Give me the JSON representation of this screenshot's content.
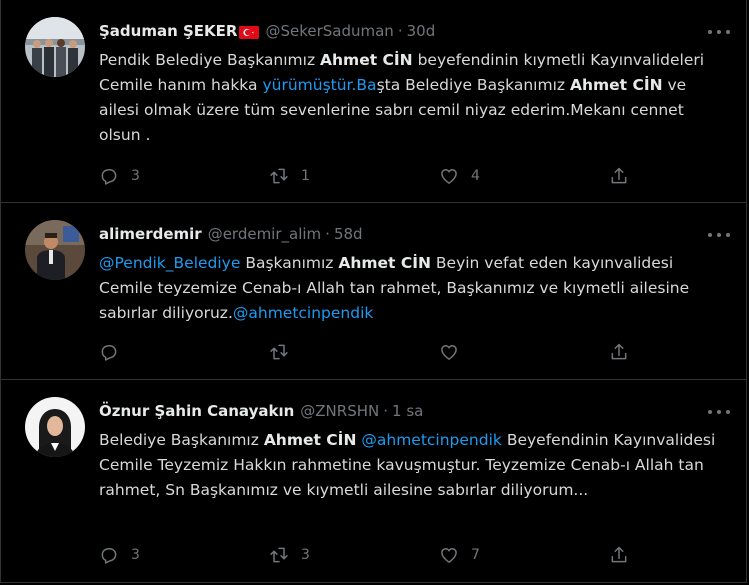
{
  "tweets": [
    {
      "name": "Şaduman ŞEKER",
      "handle": "@SekerSaduman",
      "dot": "·",
      "time": "30d",
      "text": {
        "p1": "Pendik Belediye Başkanımız ",
        "b1": "Ahmet CİN",
        "p2": " beyefendinin kıymetli Kayınvalideleri Cemile hanım hakka ",
        "link1": "yürümüştür.Ba",
        "p3": "şta Belediye Başkanımız ",
        "b2": "Ahmet CİN",
        "p4": " ve ailesi olmak üzere tüm sevenlerine sabrı cemil niyaz ederim.Mekanı cennet olsun ."
      },
      "counts": {
        "reply": "3",
        "retweet": "1",
        "like": "4"
      }
    },
    {
      "name": "alimerdemir",
      "handle": "@erdemir_alim",
      "dot": "·",
      "time": "58d",
      "text": {
        "link1": "@Pendik_Belediye",
        "p1": " Başkanımız ",
        "b1": "Ahmet CİN",
        "p2": " Beyin vefat eden kayınvalidesi Cemile teyzemize Cenab-ı Allah tan rahmet, Başkanımız ve kıymetli ailesine sabırlar diliyoruz.",
        "link2": "@ahmetcinpendik"
      },
      "counts": {
        "reply": "",
        "retweet": "",
        "like": ""
      }
    },
    {
      "name": "Öznur Şahin Canayakın",
      "handle": "@ZNRSHN",
      "dot": "·",
      "time": "1 sa",
      "text": {
        "p1": "Belediye Başkanımız ",
        "b1": "Ahmet CİN",
        "p2": " ",
        "link1": "@ahmetcinpendik",
        "p3": " Beyefendinin Kayınvalidesi Cemile Teyzemiz Hakkın rahmetine kavuşmuştur. Teyzemize Cenab-ı Allah tan rahmet, Sn Başkanımız ve kıymetli ailesine sabırlar diliyorum..."
      },
      "counts": {
        "reply": "3",
        "retweet": "3",
        "like": "7"
      }
    }
  ],
  "icons": [
    "reply-icon",
    "retweet-icon",
    "like-icon",
    "share-icon",
    "more-icon",
    "turkey-flag-icon"
  ],
  "colors": {
    "background": "#000000",
    "link": "#1d9bf0",
    "muted": "#71767b",
    "border": "#2f3336"
  }
}
